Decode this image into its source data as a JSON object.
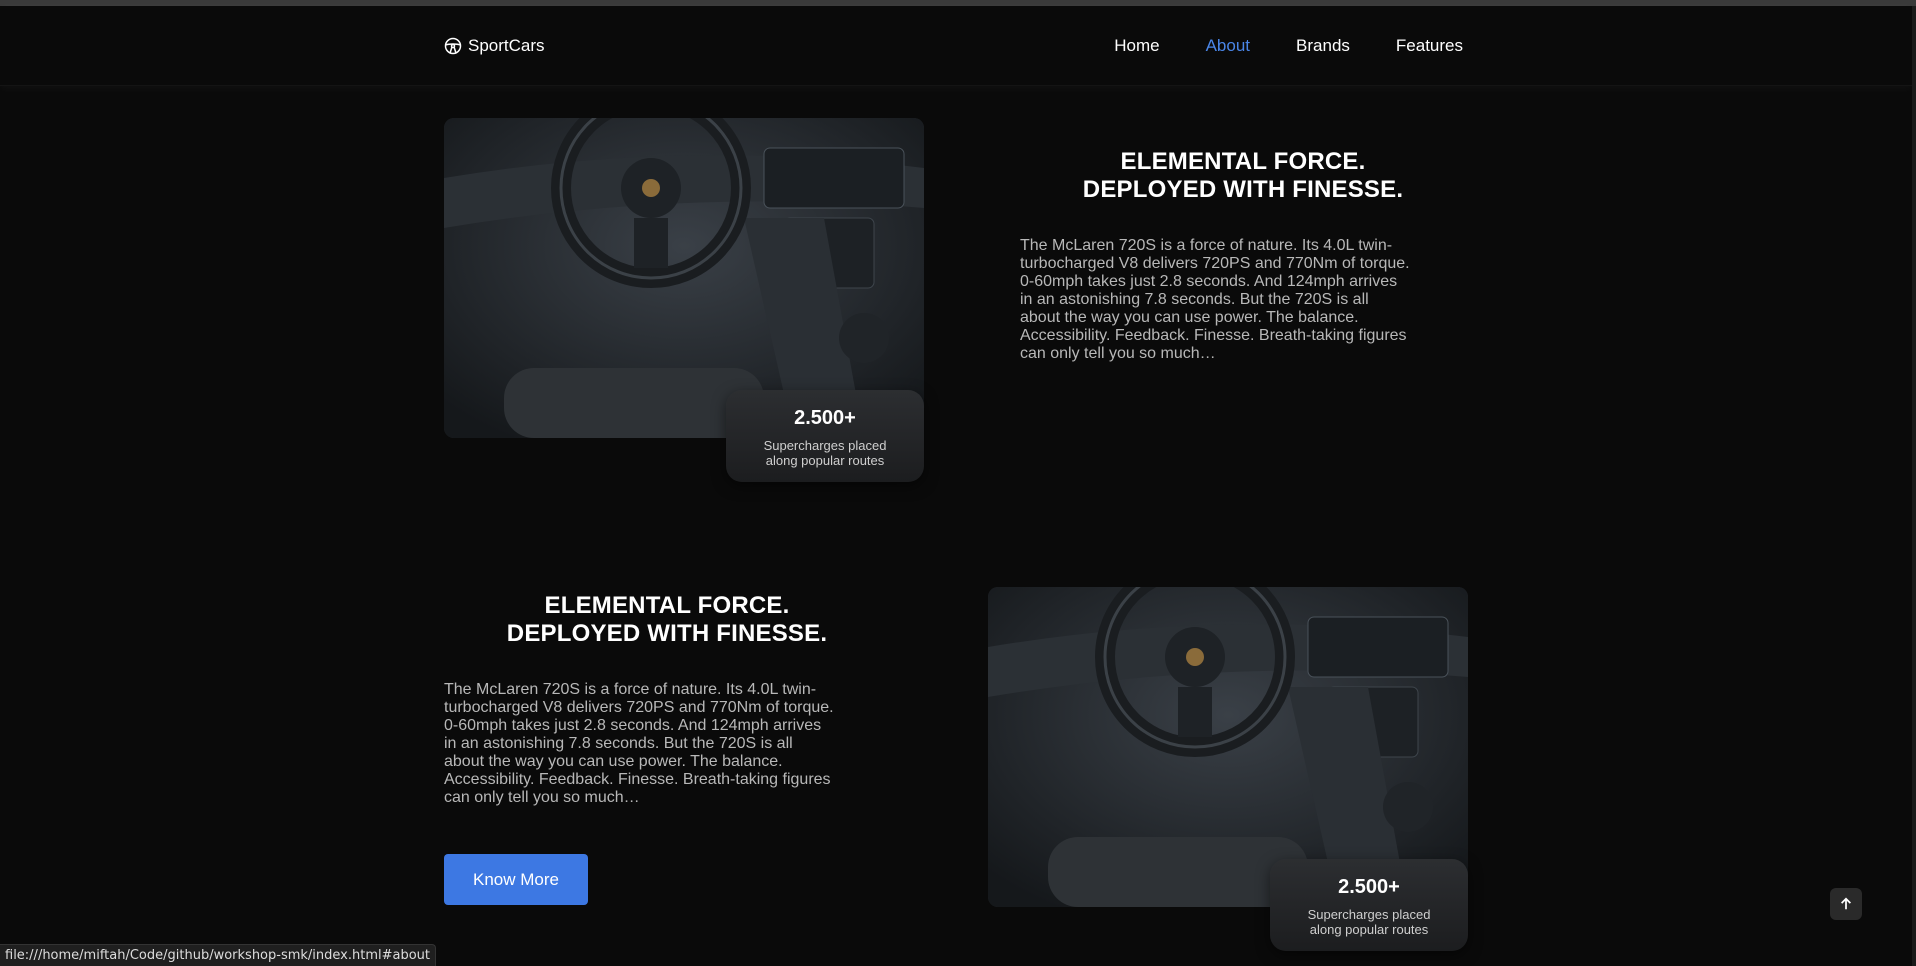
{
  "navbar": {
    "brand": "SportCars",
    "links": [
      "Home",
      "About",
      "Brands",
      "Features"
    ],
    "active_link": "About",
    "accent_color": "#4a86e8"
  },
  "sections": [
    {
      "heading_line1": "ELEMENTAL FORCE.",
      "heading_line2": "DEPLOYED WITH FINESSE.",
      "body": "The McLaren 720S is a force of nature. Its 4.0L twin-turbocharged V8 delivers 720PS and 770Nm of torque. 0-60mph takes just 2.8 seconds. And 124mph arrives in an astonishing 7.8 seconds. But the 720S is all about the way you can use power. The balance. Accessibility. Feedback. Finesse. Breath-taking figures can only tell you so much…",
      "stat_value": "2.500+",
      "stat_caption_line1": "Supercharges placed",
      "stat_caption_line2": "along popular routes"
    },
    {
      "heading_line1": "ELEMENTAL FORCE.",
      "heading_line2": "DEPLOYED WITH FINESSE.",
      "body": "The McLaren 720S is a force of nature. Its 4.0L twin-turbocharged V8 delivers 720PS and 770Nm of torque. 0-60mph takes just 2.8 seconds. And 124mph arrives in an astonishing 7.8 seconds. But the 720S is all about the way you can use power. The balance. Accessibility. Feedback. Finesse. Breath-taking figures can only tell you so much…",
      "stat_value": "2.500+",
      "stat_caption_line1": "Supercharges placed",
      "stat_caption_line2": "along popular routes",
      "button_label": "Know More",
      "button_color": "#3d78e3"
    }
  ],
  "status_bar": {
    "url": "file:///home/miftah/Code/github/workshop-smk/index.html#about"
  },
  "icons": {
    "brand": "steering-wheel-icon",
    "back_to_top": "arrow-up-icon"
  }
}
